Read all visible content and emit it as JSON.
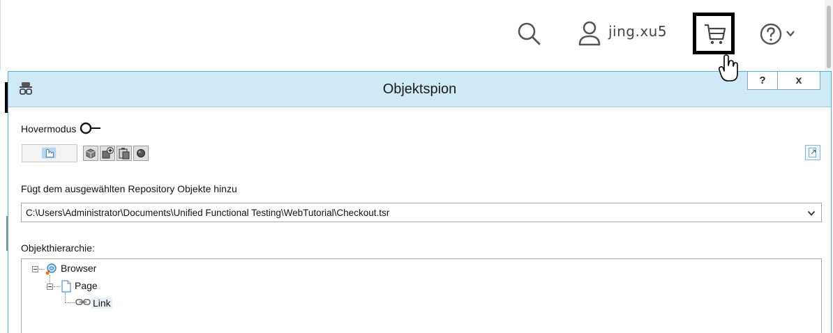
{
  "header": {
    "username": "jing.xu5",
    "icons": [
      "search-icon",
      "user-icon",
      "cart-icon",
      "help-icon",
      "chevron-down-icon"
    ]
  },
  "dialog": {
    "title": "Objektspion",
    "help_label": "?",
    "close_label": "x",
    "hover_mode_label": "Hovermodus",
    "repo_label": "Fügt dem ausgewählten Repository Objekte hinzu",
    "repo_path": "C:\\Users\\Administrator\\Documents\\Unified Functional Testing\\WebTutorial\\Checkout.tsr",
    "hierarchy_label": "Objekthierarchie:",
    "tree": [
      {
        "label": "Browser",
        "icon": "browser-icon"
      },
      {
        "label": "Page",
        "icon": "page-icon"
      },
      {
        "label": "Link",
        "icon": "link-icon"
      }
    ]
  },
  "colors": {
    "titlebar": "#cfe9f6",
    "dialog_border": "#4fb3d6",
    "cart_highlight_border": "#000000"
  }
}
